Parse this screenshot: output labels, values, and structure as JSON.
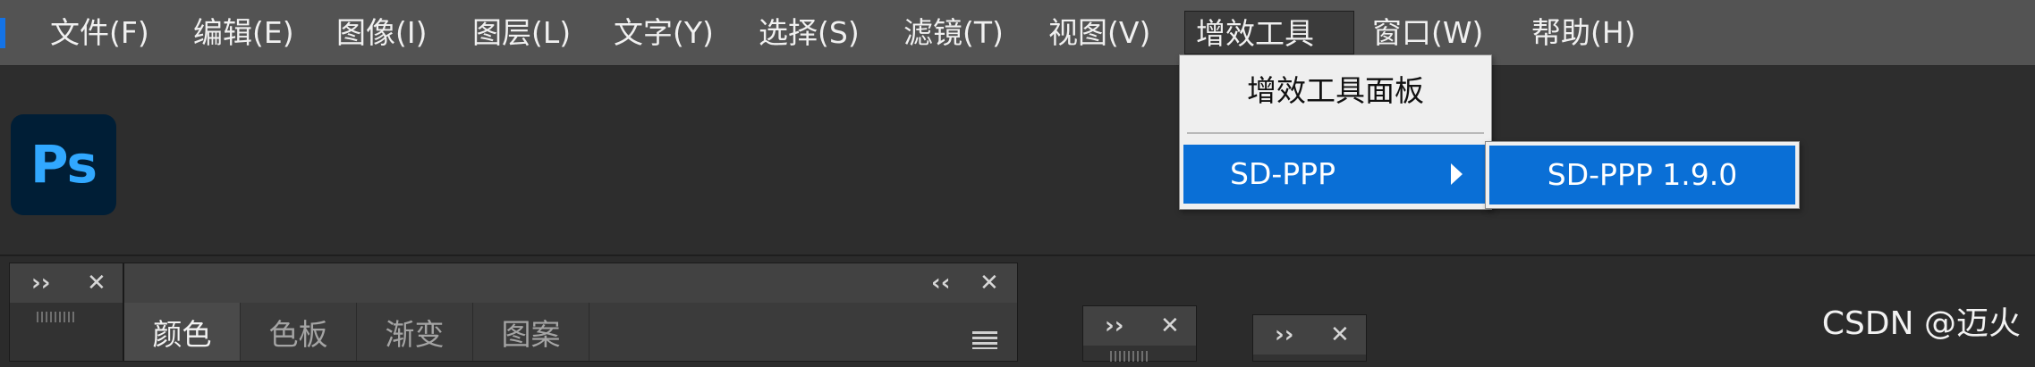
{
  "menubar": {
    "items": [
      {
        "label": "文件(F)",
        "name": "menu-file"
      },
      {
        "label": "编辑(E)",
        "name": "menu-edit"
      },
      {
        "label": "图像(I)",
        "name": "menu-image"
      },
      {
        "label": "图层(L)",
        "name": "menu-layer"
      },
      {
        "label": "文字(Y)",
        "name": "menu-type"
      },
      {
        "label": "选择(S)",
        "name": "menu-select"
      },
      {
        "label": "滤镜(T)",
        "name": "menu-filter"
      },
      {
        "label": "视图(V)",
        "name": "menu-view"
      },
      {
        "label": "增效工具",
        "name": "menu-plugins"
      },
      {
        "label": "窗口(W)",
        "name": "menu-window"
      },
      {
        "label": "帮助(H)",
        "name": "menu-help"
      }
    ]
  },
  "app": {
    "logo_text": "Ps"
  },
  "dropdown": {
    "items": [
      {
        "label": "增效工具面板"
      },
      {
        "label": "SD-PPP"
      }
    ]
  },
  "submenu": {
    "items": [
      {
        "label": "SD-PPP 1.9.0"
      }
    ]
  },
  "panels": {
    "collapse_icon": "››",
    "expand_icon": "‹‹",
    "close_icon": "✕",
    "color_panel": {
      "tabs": [
        {
          "label": "颜色"
        },
        {
          "label": "色板"
        },
        {
          "label": "渐变"
        },
        {
          "label": "图案"
        }
      ]
    }
  },
  "watermark": "CSDN @迈火"
}
